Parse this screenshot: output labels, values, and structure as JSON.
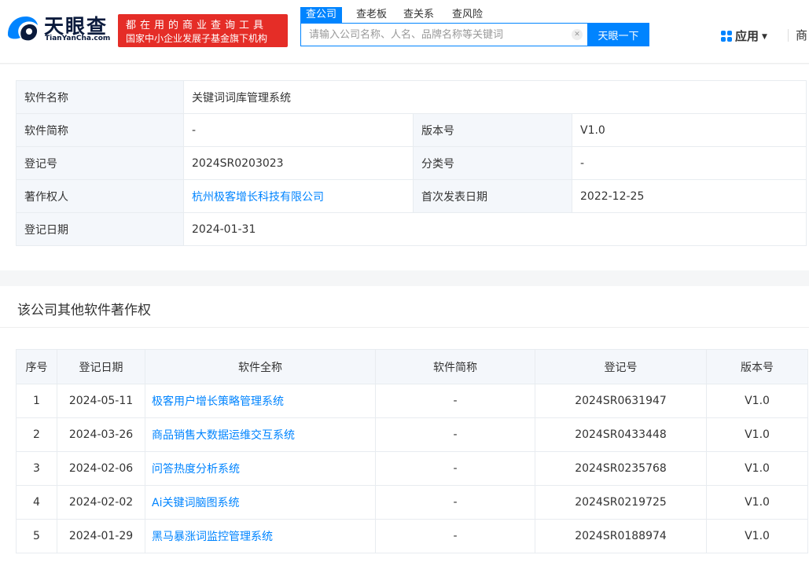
{
  "header": {
    "logo_title": "天眼查",
    "logo_domain": "TianYanCha.com",
    "slogan_line1": "都在用的商业查询工具",
    "slogan_line2": "国家中小企业发展子基金旗下机构",
    "search_tabs": [
      {
        "label": "查公司",
        "active": true
      },
      {
        "label": "查老板",
        "active": false
      },
      {
        "label": "查关系",
        "active": false
      },
      {
        "label": "查风险",
        "active": false
      }
    ],
    "search_placeholder": "请输入公司名称、人名、品牌名称等关键词",
    "search_value": "",
    "search_button": "天眼一下",
    "apps_label": "应用",
    "business_label": "商"
  },
  "detail": {
    "software_name_label": "软件名称",
    "software_name": "关键词词库管理系统",
    "short_name_label": "软件简称",
    "short_name": "-",
    "version_label": "版本号",
    "version": "V1.0",
    "reg_no_label": "登记号",
    "reg_no": "2024SR0203023",
    "category_label": "分类号",
    "category": "-",
    "owner_label": "著作权人",
    "owner": "杭州极客增长科技有限公司",
    "first_pub_label": "首次发表日期",
    "first_pub": "2022-12-25",
    "reg_date_label": "登记日期",
    "reg_date": "2024-01-31"
  },
  "other": {
    "title": "该公司其他软件著作权",
    "columns": [
      "序号",
      "登记日期",
      "软件全称",
      "软件简称",
      "登记号",
      "版本号"
    ],
    "rows": [
      {
        "no": "1",
        "date": "2024-05-11",
        "name": "极客用户增长策略管理系统",
        "short": "-",
        "reg_no": "2024SR0631947",
        "version": "V1.0"
      },
      {
        "no": "2",
        "date": "2024-03-26",
        "name": "商品销售大数据运维交互系统",
        "short": "-",
        "reg_no": "2024SR0433448",
        "version": "V1.0"
      },
      {
        "no": "3",
        "date": "2024-02-06",
        "name": "问答热度分析系统",
        "short": "-",
        "reg_no": "2024SR0235768",
        "version": "V1.0"
      },
      {
        "no": "4",
        "date": "2024-02-02",
        "name": "Ai关键词脑图系统",
        "short": "-",
        "reg_no": "2024SR0219725",
        "version": "V1.0"
      },
      {
        "no": "5",
        "date": "2024-01-29",
        "name": "黑马暴涨词监控管理系统",
        "short": "-",
        "reg_no": "2024SR0188974",
        "version": "V1.0"
      }
    ]
  },
  "colors": {
    "brand_blue": "#0084ff",
    "slogan_red": "#e52d27",
    "label_bg": "#f4f7fb"
  }
}
